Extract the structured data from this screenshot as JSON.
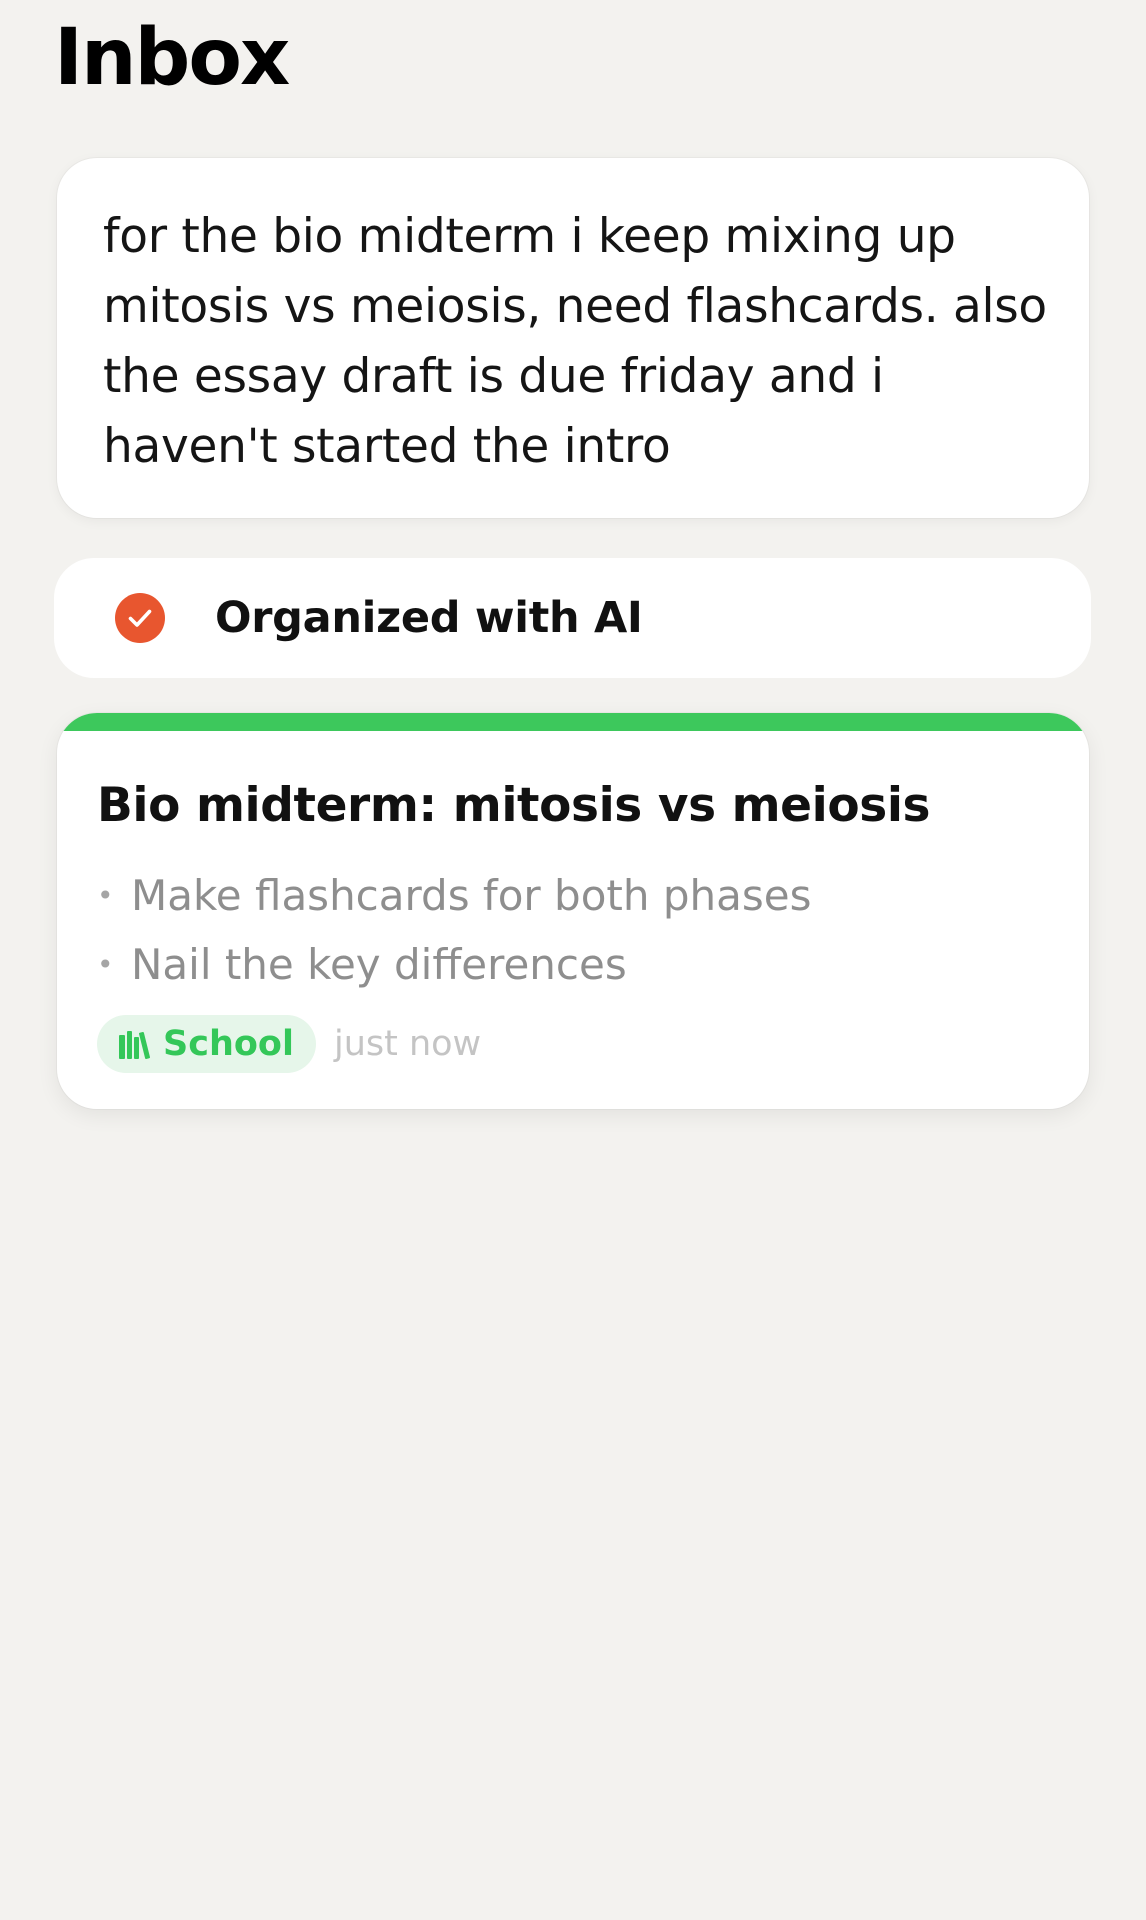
{
  "header": {
    "title": "Inbox"
  },
  "note": {
    "text": "for the bio midterm i keep mixing up mitosis vs meiosis, need flashcards. also the essay draft is due friday and i haven't started the intro"
  },
  "status": {
    "label": "Organized with AI",
    "icon": "check-circle-icon",
    "icon_color": "#e8562f"
  },
  "task_card": {
    "title": "Bio midterm: mitosis vs meiosis",
    "accent_color": "#3dc85c",
    "bullets": [
      "Make flashcards for both phases",
      "Nail the key differences"
    ],
    "category": {
      "label": "School",
      "icon": "books-icon",
      "color": "#34c759",
      "background": "#e6f6ea"
    },
    "timestamp": "just now"
  }
}
